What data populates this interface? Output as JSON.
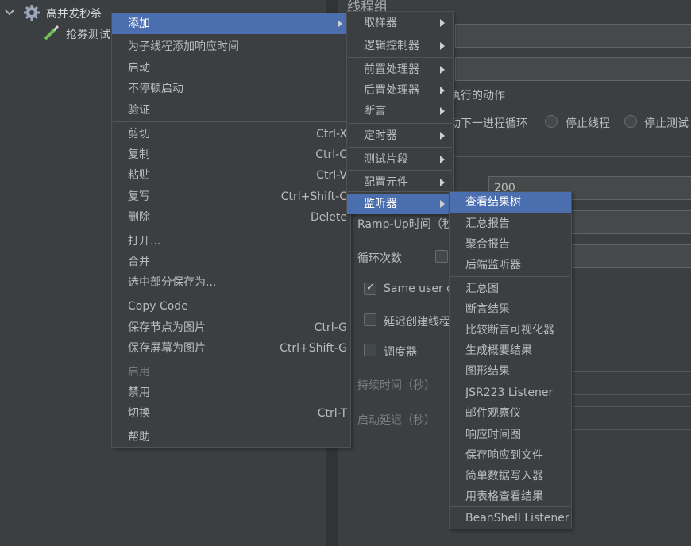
{
  "tree": {
    "thread_group": "高并发秒杀",
    "child_sampler": "抢券测试"
  },
  "right": {
    "title": "线程组",
    "action_label": "执行的动作",
    "opt_next_loop": "动下一进程循环",
    "opt_stop_thread": "停止线程",
    "opt_stop_test": "停止测试",
    "threads_value": "200",
    "rampup_label": "Ramp-Up时间（秒",
    "loop_label": "循环次数",
    "same_user": "Same user on",
    "delay_create": "延迟创建线程",
    "scheduler": "调度器",
    "duration": "持续时间（秒）",
    "startup_delay": "启动延迟（秒）"
  },
  "context_menu": {
    "items": [
      {
        "label": "添加",
        "shortcut": "",
        "submenu": true,
        "state": "selected"
      },
      {
        "label": "为子线程添加响应时间",
        "shortcut": ""
      },
      {
        "label": "启动",
        "shortcut": ""
      },
      {
        "label": "不停顿启动",
        "shortcut": ""
      },
      {
        "label": "验证",
        "shortcut": ""
      },
      {
        "label": "剪切",
        "shortcut": "Ctrl-X"
      },
      {
        "label": "复制",
        "shortcut": "Ctrl-C"
      },
      {
        "label": "粘贴",
        "shortcut": "Ctrl-V"
      },
      {
        "label": "复写",
        "shortcut": "Ctrl+Shift-C"
      },
      {
        "label": "删除",
        "shortcut": "Delete"
      },
      {
        "label": "打开...",
        "shortcut": ""
      },
      {
        "label": "合并",
        "shortcut": ""
      },
      {
        "label": "选中部分保存为...",
        "shortcut": ""
      },
      {
        "label": "Copy Code",
        "shortcut": ""
      },
      {
        "label": "保存节点为图片",
        "shortcut": "Ctrl-G"
      },
      {
        "label": "保存屏幕为图片",
        "shortcut": "Ctrl+Shift-G"
      },
      {
        "label": "启用",
        "shortcut": "",
        "state": "disabled"
      },
      {
        "label": "禁用",
        "shortcut": ""
      },
      {
        "label": "切换",
        "shortcut": "Ctrl-T"
      },
      {
        "label": "帮助",
        "shortcut": ""
      }
    ]
  },
  "add_submenu": {
    "items": [
      {
        "label": "取样器"
      },
      {
        "label": "逻辑控制器"
      },
      {
        "label": "前置处理器"
      },
      {
        "label": "后置处理器"
      },
      {
        "label": "断言"
      },
      {
        "label": "定时器"
      },
      {
        "label": "测试片段"
      },
      {
        "label": "配置元件"
      },
      {
        "label": "监听器",
        "state": "selected"
      }
    ]
  },
  "listener_submenu": {
    "items": [
      {
        "label": "查看结果树",
        "state": "selected"
      },
      {
        "label": "汇总报告"
      },
      {
        "label": "聚合报告"
      },
      {
        "label": "后端监听器"
      },
      {
        "label": "汇总图"
      },
      {
        "label": "断言结果"
      },
      {
        "label": "比较断言可视化器"
      },
      {
        "label": "生成概要结果"
      },
      {
        "label": "图形结果"
      },
      {
        "label": "JSR223 Listener"
      },
      {
        "label": "邮件观察仪"
      },
      {
        "label": "响应时间图"
      },
      {
        "label": "保存响应到文件"
      },
      {
        "label": "简单数据写入器"
      },
      {
        "label": "用表格查看结果"
      },
      {
        "label": "BeanShell Listener"
      }
    ]
  },
  "colors": {
    "background": "#3c3f41",
    "selection": "#4b6eaf",
    "text": "#bbbbbb"
  }
}
